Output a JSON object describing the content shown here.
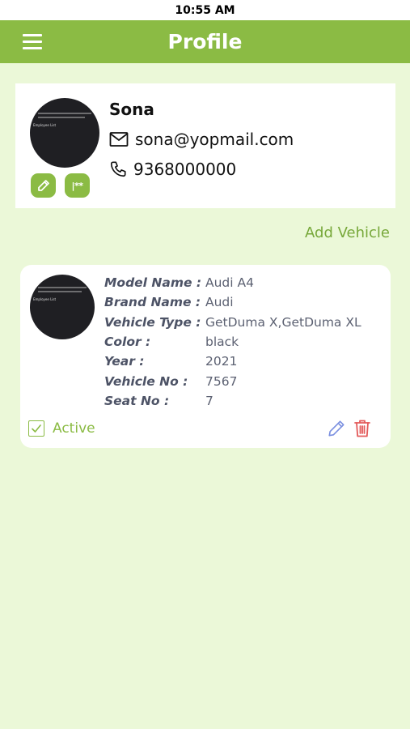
{
  "status_bar": {
    "time": "10:55 AM"
  },
  "app_bar": {
    "title": "Profile",
    "menu_icon": "hamburger-menu-icon"
  },
  "profile": {
    "name": "Sona",
    "email": "sona@yopmail.com",
    "phone": "9368000000",
    "avatar_caption": "Employee List",
    "password_button_label": "|**",
    "icons": {
      "email": "envelope-icon",
      "phone": "phone-icon",
      "edit": "pencil-icon"
    }
  },
  "actions": {
    "add_vehicle_label": "Add Vehicle"
  },
  "vehicles": [
    {
      "avatar_caption": "Employee List",
      "specs": [
        {
          "label": "Model Name :",
          "value": "Audi A4"
        },
        {
          "label": "Brand Name :",
          "value": "Audi"
        },
        {
          "label": "Vehicle Type :",
          "value": "GetDuma X,GetDuma XL"
        },
        {
          "label": "Color :",
          "value": "black"
        },
        {
          "label": "Year :",
          "value": "2021"
        },
        {
          "label": "Vehicle No :",
          "value": "7567"
        },
        {
          "label": "Seat No :",
          "value": "7"
        }
      ],
      "active_label": "Active",
      "active_checked": true,
      "icons": {
        "edit": "pencil-icon",
        "delete": "trash-icon"
      }
    }
  ],
  "colors": {
    "brand_green": "#8bbb44",
    "link_green": "#77a83a",
    "background": "#ebf8d8",
    "edit_blue": "#7a8fe0",
    "delete_red": "#e35a5a"
  }
}
